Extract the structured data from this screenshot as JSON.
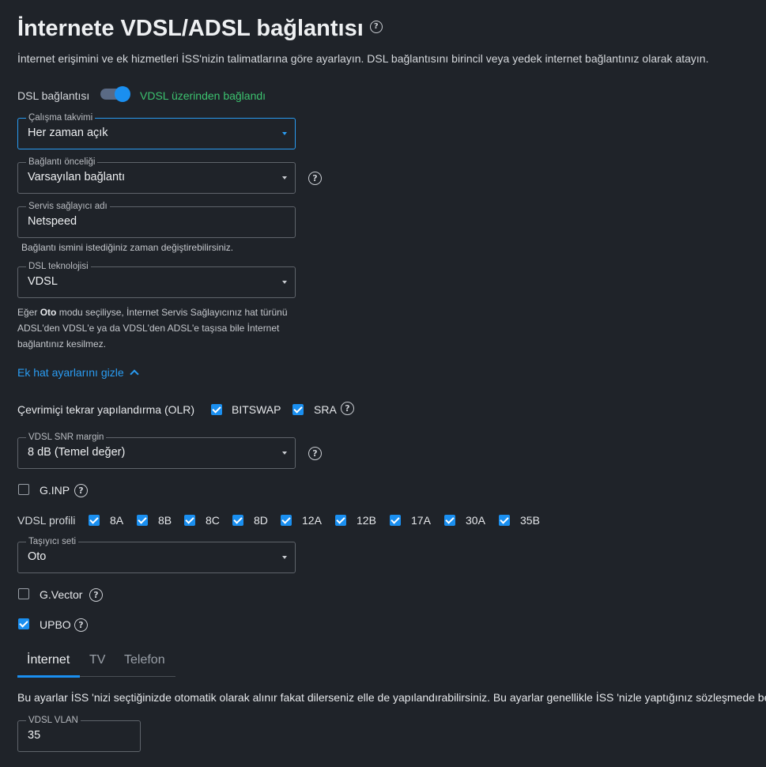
{
  "page": {
    "title": "İnternete VDSL/ADSL bağlantısı",
    "subtitle": "İnternet erişimini ve ek hizmetleri İSS'nizin talimatlarına göre ayarlayın. DSL bağlantısını birincil veya yedek internet bağlantınız olarak atayın."
  },
  "dsl": {
    "label": "DSL bağlantısı",
    "enabled": true,
    "status": "VDSL üzerinden bağlandı"
  },
  "schedule": {
    "label": "Çalışma takvimi",
    "value": "Her zaman açık"
  },
  "priority": {
    "label": "Bağlantı önceliği",
    "value": "Varsayılan bağlantı"
  },
  "provider": {
    "label": "Servis sağlayıcı adı",
    "value": "Netspeed",
    "hint": "Bağlantı ismini istediğiniz zaman değiştirebilirsiniz."
  },
  "technology": {
    "label": "DSL teknolojisi",
    "value": "VDSL"
  },
  "oto_note": {
    "prefix": "Eğer ",
    "bold": "Oto",
    "line1_rest": " modu seçiliyse, İnternet Servis Sağlayıcınız hat türünü",
    "line2": "ADSL'den VDSL'e ya da VDSL'den ADSL'e taşısa bile İnternet",
    "line3": "bağlantınız kesilmez."
  },
  "advanced_link": "Ek hat ayarlarını gizle",
  "olr": {
    "label": "Çevrimiçi tekrar yapılandırma (OLR)",
    "options": [
      {
        "label": "BITSWAP",
        "checked": true
      },
      {
        "label": "SRA",
        "checked": true
      }
    ]
  },
  "snr": {
    "label": "VDSL SNR margin",
    "value": "8 dB (Temel değer)"
  },
  "ginp": {
    "label": "G.INP",
    "checked": false
  },
  "profiles": {
    "label": "VDSL profili",
    "items": [
      {
        "label": "8A",
        "checked": true
      },
      {
        "label": "8B",
        "checked": true
      },
      {
        "label": "8C",
        "checked": true
      },
      {
        "label": "8D",
        "checked": true
      },
      {
        "label": "12A",
        "checked": true
      },
      {
        "label": "12B",
        "checked": true
      },
      {
        "label": "17A",
        "checked": true
      },
      {
        "label": "30A",
        "checked": true
      },
      {
        "label": "35B",
        "checked": true
      }
    ]
  },
  "carrier": {
    "label": "Taşıyıcı seti",
    "value": "Oto"
  },
  "gvector": {
    "label": "G.Vector",
    "checked": false
  },
  "upbo": {
    "label": "UPBO",
    "checked": true
  },
  "tabs": [
    {
      "label": "İnternet",
      "active": true
    },
    {
      "label": "TV",
      "active": false
    },
    {
      "label": "Telefon",
      "active": false
    }
  ],
  "tab_note": "Bu ayarlar İSS 'nizi seçtiğinizde otomatik olarak alınır fakat dilerseniz elle de yapılandırabilirsiniz. Bu ayarlar genellikle İSS 'nizle yaptığınız sözleşmede belirtilir.",
  "vlan": {
    "label": "VDSL VLAN",
    "value": "35"
  },
  "colors": {
    "accent": "#1a8ff0",
    "success": "#3cc26f",
    "background": "#1f2329"
  }
}
